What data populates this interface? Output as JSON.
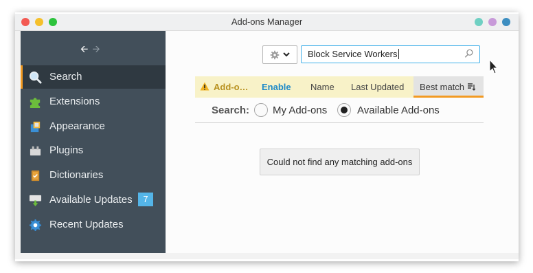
{
  "window": {
    "title": "Add-ons Manager"
  },
  "sidebar": {
    "items": [
      {
        "label": "Search",
        "icon": "search-icon",
        "selected": true
      },
      {
        "label": "Extensions",
        "icon": "puzzle-icon"
      },
      {
        "label": "Appearance",
        "icon": "appearance-icon"
      },
      {
        "label": "Plugins",
        "icon": "plugin-icon"
      },
      {
        "label": "Dictionaries",
        "icon": "dictionary-icon"
      },
      {
        "label": "Available Updates",
        "icon": "update-icon",
        "badge": "7"
      },
      {
        "label": "Recent Updates",
        "icon": "gear-update-icon"
      }
    ]
  },
  "search": {
    "value": "Block Service Workers"
  },
  "sort": {
    "warning_label": "Add-o…",
    "enable_label": "Enable",
    "name_label": "Name",
    "updated_label": "Last Updated",
    "best_match_label": "Best match"
  },
  "scope": {
    "label": "Search:",
    "option_my": "My Add-ons",
    "option_available": "Available Add-ons",
    "selected": "available"
  },
  "results": {
    "empty_message": "Could not find any matching add-ons"
  },
  "colors": {
    "sidebar_bg": "#424f5a",
    "accent_orange": "#f29a22",
    "badge_blue": "#54b5e8",
    "search_border": "#3daee9",
    "enable_blue": "#1d89c8"
  }
}
